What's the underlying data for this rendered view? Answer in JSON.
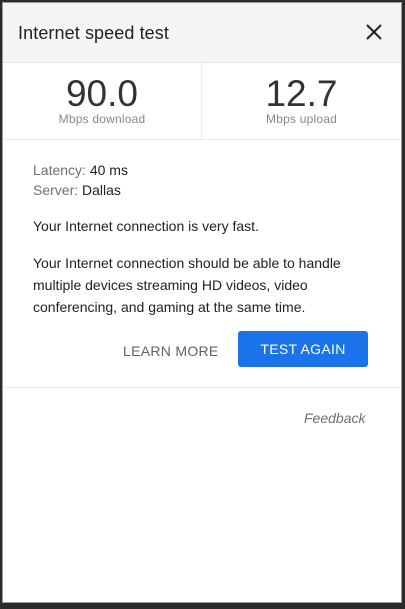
{
  "dialog": {
    "title": "Internet speed test",
    "close_icon": "close-icon"
  },
  "download": {
    "value": "90.0",
    "unit": "Mbps download"
  },
  "upload": {
    "value": "12.7",
    "unit": "Mbps upload"
  },
  "details": {
    "latency_label": "Latency:",
    "latency_value": "40 ms",
    "server_label": "Server:",
    "server_value": "Dallas"
  },
  "summary": "Your Internet connection is very fast.",
  "description": "Your Internet connection should be able to handle multiple devices streaming HD videos, video conferencing, and gaming at the same time.",
  "actions": {
    "learn_more": "LEARN MORE",
    "test_again": "TEST AGAIN"
  },
  "feedback": "Feedback",
  "colors": {
    "accent": "#1a73e8",
    "header_bg": "#f5f5f5"
  }
}
